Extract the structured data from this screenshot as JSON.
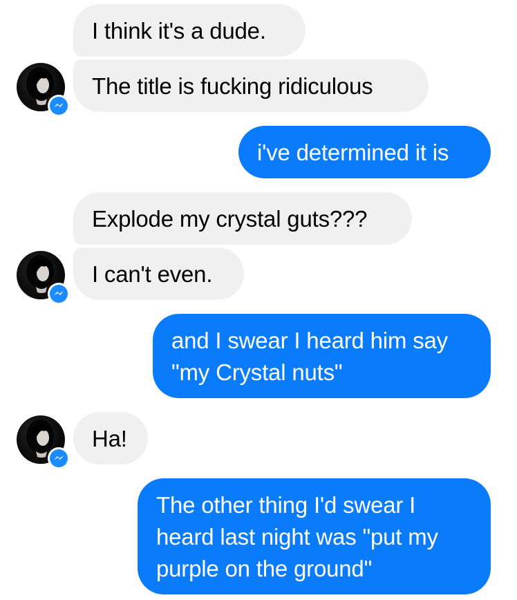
{
  "conversation": {
    "messages": [
      {
        "sender": "them",
        "text": "I think it's a dude."
      },
      {
        "sender": "them",
        "text": "The title is fucking ridiculous"
      },
      {
        "sender": "me",
        "text": "i've determined it is"
      },
      {
        "sender": "them",
        "text": "Explode my crystal guts???"
      },
      {
        "sender": "them",
        "text": "I can't even."
      },
      {
        "sender": "me",
        "text": "and I swear I heard him say\n\"my Crystal nuts\""
      },
      {
        "sender": "them",
        "text": "Ha!"
      },
      {
        "sender": "me",
        "text": "The other thing I'd swear I\nheard last night was \"put my\npurple on the ground\""
      }
    ]
  },
  "colors": {
    "incoming_bubble": "#f0f0f0",
    "outgoing_bubble": "#0a7cfb",
    "messenger_badge": "#1a8cff"
  },
  "icons": {
    "avatar": "contact-avatar",
    "badge": "messenger-icon"
  }
}
